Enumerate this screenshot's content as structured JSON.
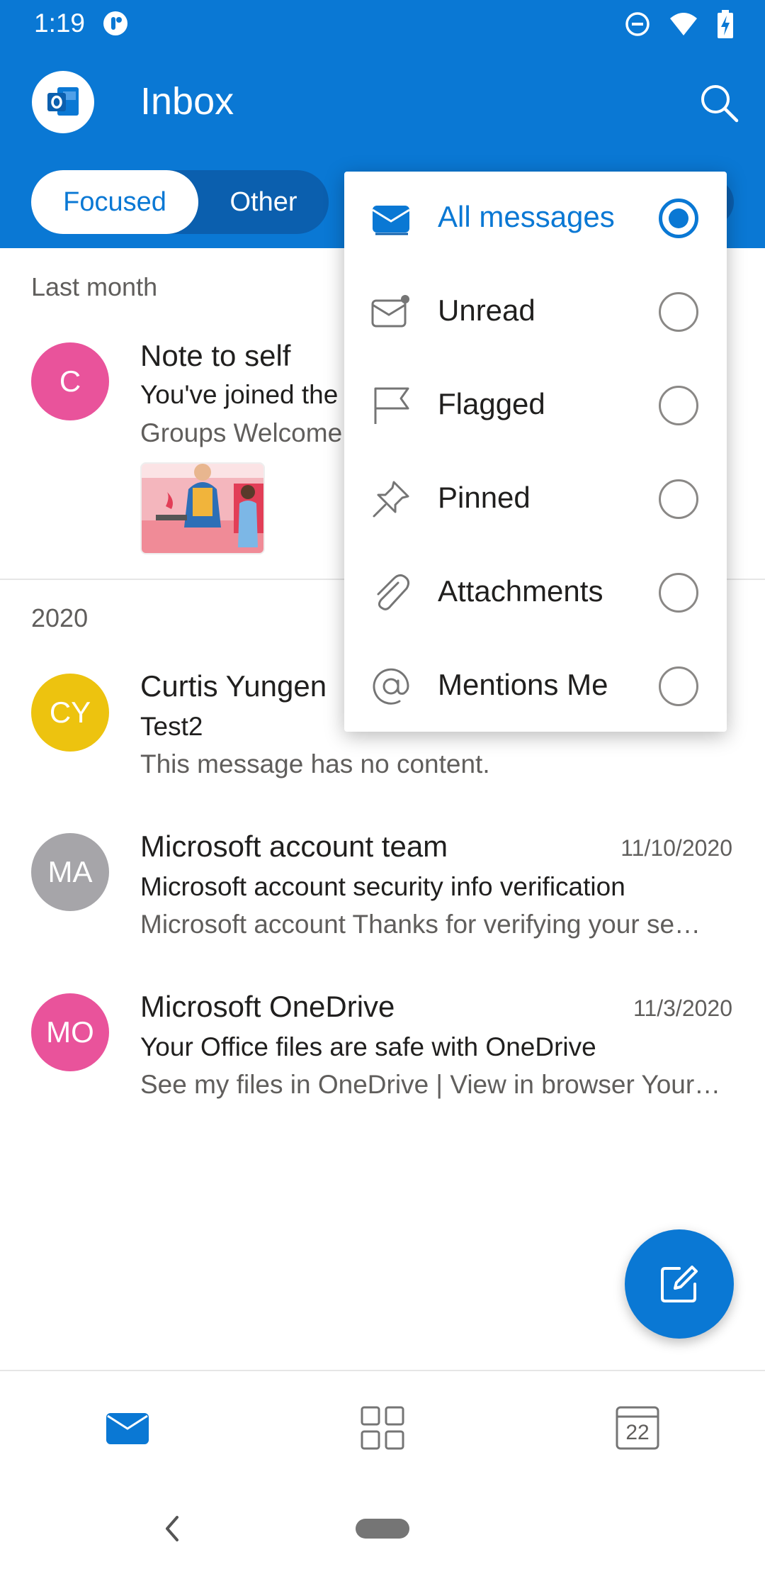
{
  "status_bar": {
    "time": "1:19"
  },
  "header": {
    "title": "Inbox"
  },
  "tabs": {
    "focused": "Focused",
    "other": "Other"
  },
  "sections": {
    "last_month": "Last month",
    "year_2020": "2020"
  },
  "emails": [
    {
      "initials": "C",
      "avatar_color": "#e9539b",
      "sender": "Note to self",
      "date": "",
      "subject": "You've joined the",
      "preview": "Groups Welcome"
    },
    {
      "initials": "CY",
      "avatar_color": "#edc30f",
      "sender": "Curtis Yungen",
      "date": "",
      "subject": "Test2",
      "preview": "This message has no content."
    },
    {
      "initials": "MA",
      "avatar_color": "#a6a5a9",
      "sender": "Microsoft account team",
      "date": "11/10/2020",
      "subject": "Microsoft account security info verification",
      "preview": "Microsoft account Thanks for verifying your se…"
    },
    {
      "initials": "MO",
      "avatar_color": "#e9539b",
      "sender": "Microsoft OneDrive",
      "date": "11/3/2020",
      "subject": "Your Office files are safe with OneDrive",
      "preview": "See my files in OneDrive | View in browser Your…"
    }
  ],
  "filter_menu": {
    "items": [
      {
        "label": "All messages",
        "icon": "envelope-filled-icon",
        "selected": true
      },
      {
        "label": "Unread",
        "icon": "envelope-unread-icon",
        "selected": false
      },
      {
        "label": "Flagged",
        "icon": "flag-icon",
        "selected": false
      },
      {
        "label": "Pinned",
        "icon": "pin-icon",
        "selected": false
      },
      {
        "label": "Attachments",
        "icon": "paperclip-icon",
        "selected": false
      },
      {
        "label": "Mentions Me",
        "icon": "at-sign-icon",
        "selected": false
      }
    ]
  },
  "bottom_nav": {
    "calendar_day": "22"
  },
  "colors": {
    "brand": "#0a78d4",
    "header_dark": "#0b5fae",
    "text": "#201f1e",
    "muted": "#605e5c"
  }
}
